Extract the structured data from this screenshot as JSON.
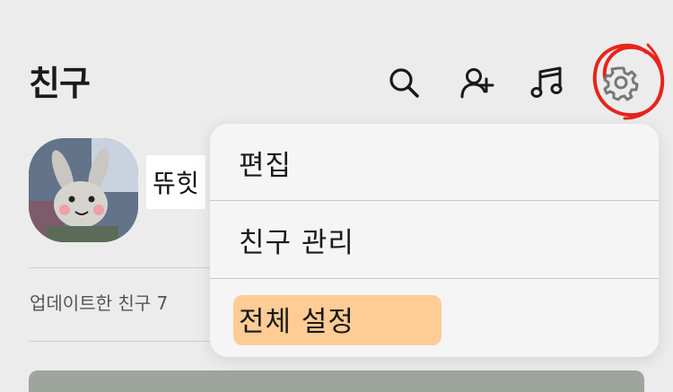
{
  "header": {
    "title": "친구",
    "icons": [
      "search-icon",
      "add-friend-icon",
      "music-icon",
      "settings-gear-icon"
    ]
  },
  "profile": {
    "name": "뜌힛"
  },
  "updated_friends_label": "업데이트한 친구 7",
  "menu": {
    "items": [
      {
        "label": "편집"
      },
      {
        "label": "친구 관리"
      },
      {
        "label": "전체 설정",
        "highlighted": true
      }
    ]
  },
  "colors": {
    "background": "#ececec",
    "menu_background": "#f5f5f5",
    "highlight": "#ffc98f",
    "annotation_circle": "#e8241c"
  }
}
